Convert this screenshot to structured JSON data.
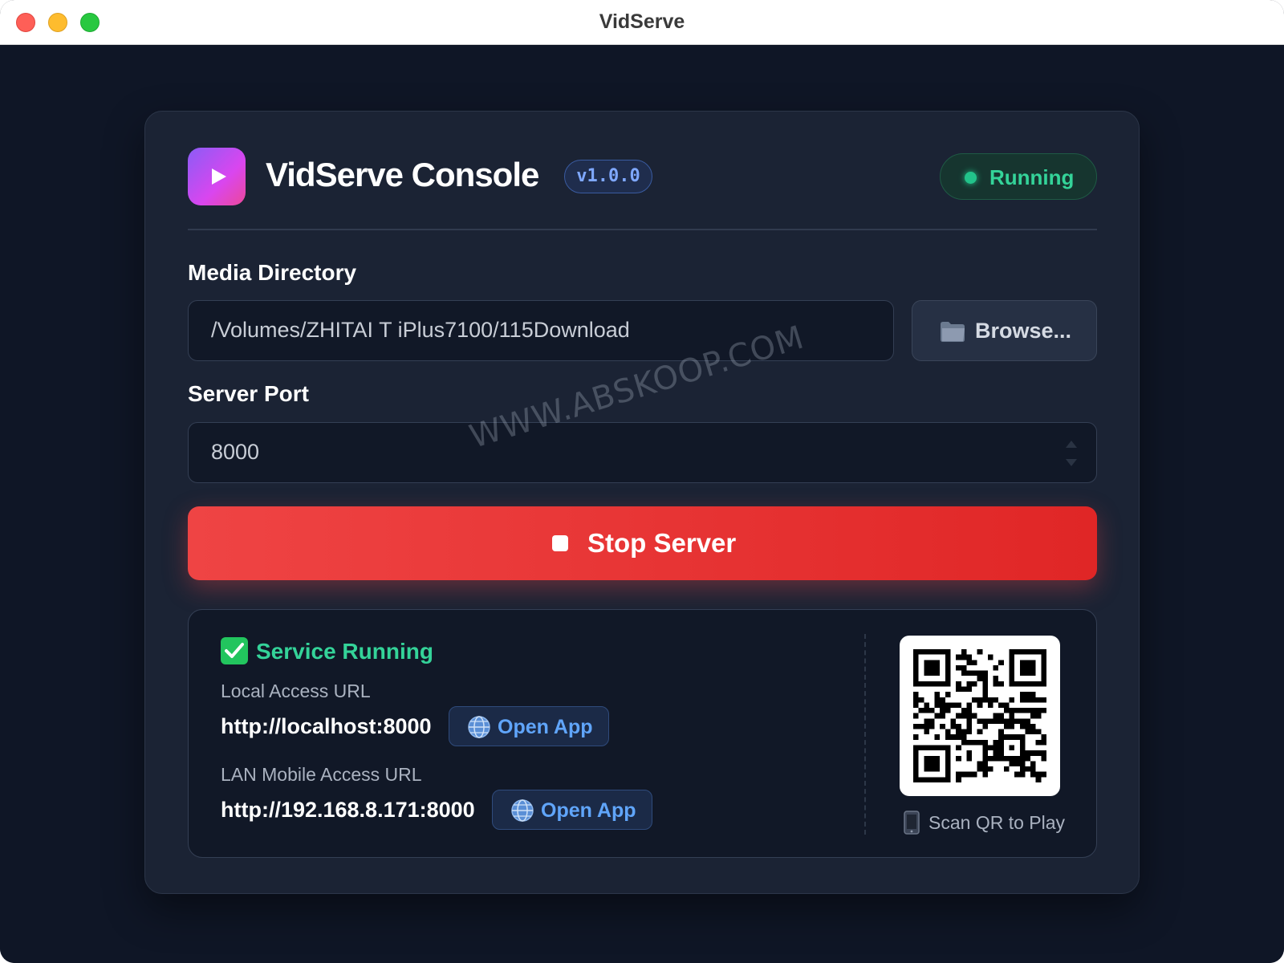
{
  "window": {
    "title": "VidServe"
  },
  "header": {
    "app_title": "VidServe Console",
    "version": "v1.0.0",
    "status": "Running"
  },
  "media": {
    "label": "Media Directory",
    "value": "/Volumes/ZHITAI T iPlus7100/115Download",
    "browse_label": "Browse..."
  },
  "port": {
    "label": "Server Port",
    "value": "8000"
  },
  "actions": {
    "stop_label": "Stop Server"
  },
  "service": {
    "title": "Service Running",
    "local_label": "Local Access URL",
    "local_url": "http://localhost:8000",
    "lan_label": "LAN Mobile Access URL",
    "lan_url": "http://192.168.8.171:8000",
    "open_label": "Open App",
    "qr_label": "Scan QR to Play"
  },
  "watermark": "WWW.ABSKOOP.COM",
  "colors": {
    "accent_danger": "#ef4444",
    "status_green": "#34d399",
    "link_blue": "#60a5fa",
    "background": "#0f1626",
    "card": "#1b2334"
  },
  "icons": [
    "play-icon",
    "folder-icon",
    "stop-icon",
    "check-icon",
    "globe-icon",
    "qr-code",
    "phone-icon"
  ]
}
